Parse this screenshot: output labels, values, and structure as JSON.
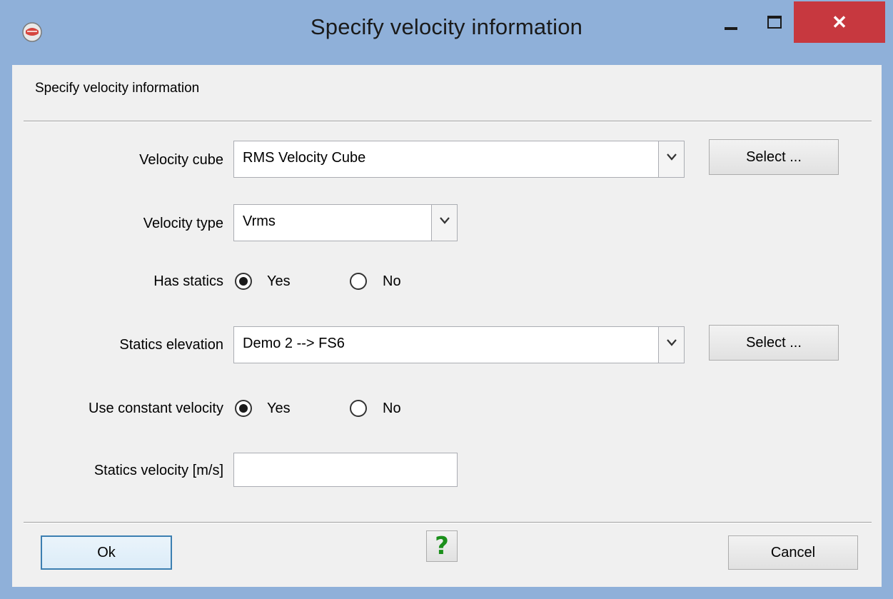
{
  "window": {
    "title": "Specify velocity information",
    "close_glyph": "✕"
  },
  "dialog": {
    "header": "Specify velocity information",
    "velocity_cube": {
      "label": "Velocity cube",
      "value": "RMS Velocity Cube",
      "select_label": "Select ..."
    },
    "velocity_type": {
      "label": "Velocity type",
      "value": "Vrms"
    },
    "has_statics": {
      "label": "Has statics",
      "yes": "Yes",
      "no": "No",
      "selected": "Yes"
    },
    "statics_elevation": {
      "label": "Statics elevation",
      "value": "Demo 2 --> FS6",
      "select_label": "Select ..."
    },
    "use_constant_velocity": {
      "label": "Use constant velocity",
      "yes": "Yes",
      "no": "No",
      "selected": "Yes"
    },
    "statics_velocity": {
      "label": "Statics velocity [m/s]",
      "value": ""
    }
  },
  "footer": {
    "ok_label": "Ok",
    "help_glyph": "?",
    "cancel_label": "Cancel"
  },
  "colors": {
    "title_bar": "#8fb0d9",
    "close_button": "#c7383f",
    "help_icon": "#1a8f1a"
  },
  "icons": {
    "app": "app-logo-icon",
    "dropdown": "chevron-down-icon",
    "help": "help-icon"
  }
}
